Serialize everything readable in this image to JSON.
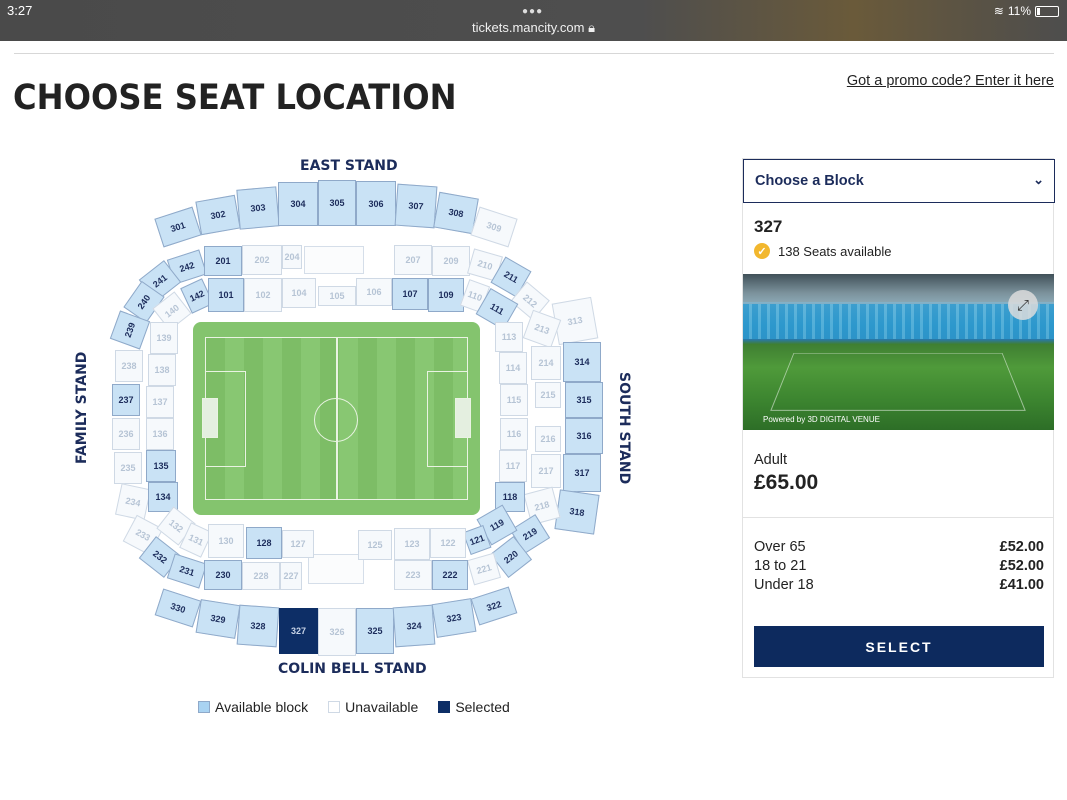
{
  "status": {
    "time": "3:27",
    "battery": "11%",
    "url": "tickets.mancity.com"
  },
  "header": {
    "title": "CHOOSE SEAT LOCATION",
    "promo_link": "Got a promo code? Enter it here"
  },
  "map": {
    "stands": {
      "east": "EAST STAND",
      "south": "SOUTH STAND",
      "family": "FAMILY STAND",
      "colin_bell": "COLIN BELL STAND"
    }
  },
  "legend": {
    "available": "Available block",
    "unavailable": "Unavailable",
    "selected": "Selected"
  },
  "panel": {
    "dropdown_label": "Choose a Block",
    "block_number": "327",
    "seats_available": "138 Seats available",
    "powered_by": "Powered by 3D DIGITAL VENUE",
    "adult_label": "Adult",
    "adult_price": "£65.00",
    "prices": [
      {
        "label": "Over 65",
        "value": "£52.00"
      },
      {
        "label": "18 to 21",
        "value": "£52.00"
      },
      {
        "label": "Under 18",
        "value": "£41.00"
      }
    ],
    "select_button": "SELECT"
  }
}
